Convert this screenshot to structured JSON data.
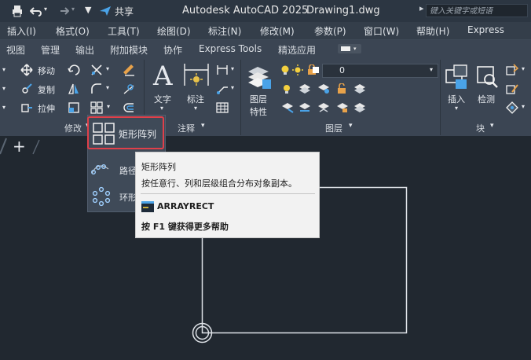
{
  "titlebar": {
    "app_title": "Autodesk AutoCAD 2025",
    "doc_title": "Drawing1.dwg",
    "share_label": "共享",
    "search_placeholder": "键入关键字或短语"
  },
  "menubar": {
    "items": [
      "插入(I)",
      "格式(O)",
      "工具(T)",
      "绘图(D)",
      "标注(N)",
      "修改(M)",
      "参数(P)",
      "窗口(W)",
      "帮助(H)",
      "Express"
    ]
  },
  "ribbon_tabs": {
    "items": [
      "视图",
      "管理",
      "输出",
      "附加模块",
      "协作",
      "Express Tools",
      "精选应用"
    ]
  },
  "ribbon": {
    "modify": {
      "move": "移动",
      "copy": "复制",
      "stretch": "拉伸",
      "footer": "修改"
    },
    "annotation": {
      "text": "文字",
      "dimension": "标注",
      "footer": "注释"
    },
    "layers": {
      "properties_line1": "图层",
      "properties_line2": "特性",
      "current_layer": "0",
      "footer": "图层"
    },
    "block": {
      "insert": "插入",
      "detect": "检测",
      "footer": "块"
    }
  },
  "dropdown": {
    "rect_array": "矩形阵列",
    "path_array": "路径",
    "polar_array": "环形"
  },
  "tooltip": {
    "title": "矩形阵列",
    "description": "按任意行、列和层级组合分布对象副本。",
    "command": "ARRAYRECT",
    "help": "按 F1 键获得更多帮助"
  },
  "colors": {
    "highlight_border": "#e0404a",
    "accent_blue": "#4aa3e8",
    "ribbon_bg": "#3b4553"
  }
}
